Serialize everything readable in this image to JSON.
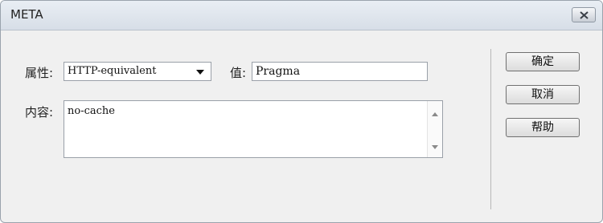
{
  "window": {
    "title": "META"
  },
  "form": {
    "attribute_label": "属性:",
    "attribute_value": "HTTP-equivalent",
    "value_label": "值:",
    "value_text": "Pragma",
    "content_label": "内容:",
    "content_text": "no-cache"
  },
  "buttons": {
    "ok": "确定",
    "cancel": "取消",
    "help": "帮助"
  },
  "icons": {
    "close": "close-icon",
    "dropdown": "chevron-down-icon",
    "scroll_up": "scroll-up-icon",
    "scroll_down": "scroll-down-icon"
  }
}
